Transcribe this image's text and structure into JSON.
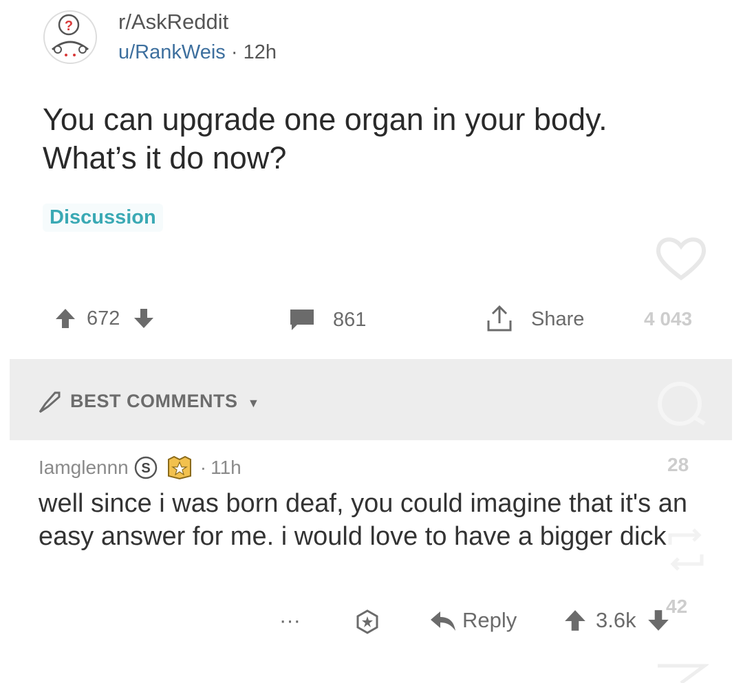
{
  "post": {
    "subreddit": "r/AskReddit",
    "author": "u/RankWeis",
    "separator": "·",
    "age": "12h",
    "title": "You can upgrade one organ in your body. What’s it do now?",
    "flair": "Discussion",
    "upvotes": "672",
    "comment_count": "861",
    "share_label": "Share"
  },
  "comments_section": {
    "sort_label": "BEST COMMENTS"
  },
  "comment": {
    "author": "Iamglennn",
    "separator": "·",
    "age": "11h",
    "body": "well since i was born deaf, you could imagine that it's an easy answer for me. i would love to have a bigger dick",
    "more_label": "···",
    "reply_label": "Reply",
    "score": "3.6k"
  },
  "overlay": {
    "like_count": "4 043",
    "comment_count": "28",
    "repost_count": "42"
  },
  "colors": {
    "flair": "#3aa9b4",
    "author_link": "#3d6f9e",
    "comments_bar": "#ededed"
  }
}
